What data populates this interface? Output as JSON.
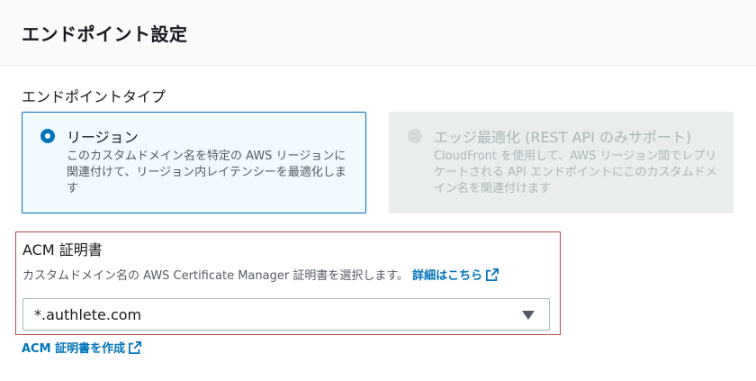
{
  "header": {
    "title": "エンドポイント設定"
  },
  "endpoint_type": {
    "label": "エンドポイントタイプ",
    "options": [
      {
        "title": "リージョン",
        "description": "このカスタムドメイン名を特定の AWS リージョンに関連付けて、リージョン内レイテンシーを最適化します",
        "selected": true,
        "disabled": false
      },
      {
        "title": "エッジ最適化 (REST API のみサポート)",
        "description": "CloudFront を使用して、AWS リージョン間でレプリケートされる API エンドポイントにこのカスタムドメイン名を関連付けます",
        "selected": false,
        "disabled": true
      }
    ]
  },
  "acm": {
    "label": "ACM 証明書",
    "description": "カスタムドメイン名の AWS Certificate Manager 証明書を選択します。",
    "details_link": "詳細はこちら",
    "selected_value": "*.authlete.com",
    "create_link": "ACM 証明書を作成"
  },
  "colors": {
    "accent": "#0073bb",
    "highlight_border": "#b94a4a",
    "disabled_bg": "#eaeded"
  },
  "icons": {
    "external": "external-link-icon",
    "caret": "caret-down-icon"
  }
}
